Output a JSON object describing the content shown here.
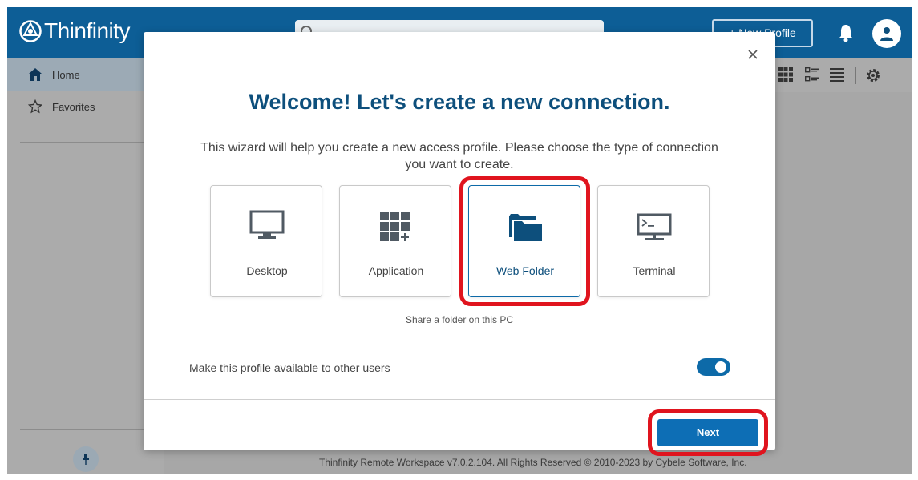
{
  "header": {
    "logo_text": "Thinfinity",
    "new_profile_label": "+ New Profile",
    "accent_color": "#0d5e96"
  },
  "sidebar": {
    "items": [
      {
        "label": "Home",
        "icon": "home-icon",
        "active": true
      },
      {
        "label": "Favorites",
        "icon": "star-icon",
        "active": false
      }
    ]
  },
  "toolbar": {
    "icons": [
      "grid-view-icon",
      "detail-view-icon",
      "list-view-icon",
      "gear-icon"
    ]
  },
  "footer": {
    "text": "Thinfinity Remote Workspace v7.0.2.104. All Rights Reserved © 2010-2023 by Cybele Software, Inc."
  },
  "modal": {
    "title": "Welcome! Let's create a new connection.",
    "description": "This wizard will help you create a new access profile. Please choose the type of connection you want to create.",
    "cards": [
      {
        "label": "Desktop",
        "icon": "monitor-icon",
        "selected": false
      },
      {
        "label": "Application",
        "icon": "app-grid-icon",
        "selected": false
      },
      {
        "label": "Web Folder",
        "icon": "folder-icon",
        "selected": true
      },
      {
        "label": "Terminal",
        "icon": "terminal-icon",
        "selected": false
      }
    ],
    "caption": "Share a folder on this PC",
    "share_label": "Make this profile available to other users",
    "share_toggle_on": true,
    "next_label": "Next",
    "highlight_color": "#e0141e"
  }
}
